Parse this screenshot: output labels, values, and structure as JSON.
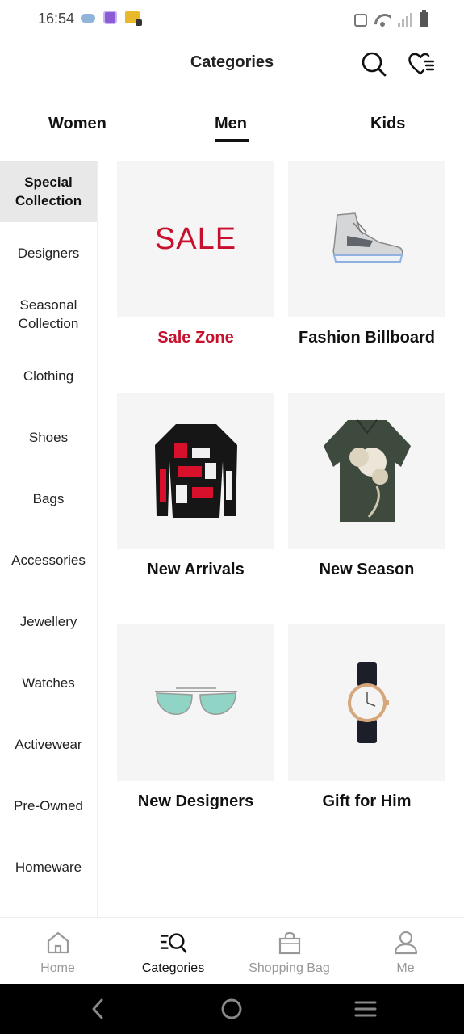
{
  "status_bar": {
    "time": "16:54"
  },
  "header": {
    "title": "Categories",
    "icons": [
      "search-icon",
      "wishlist-heart-icon"
    ]
  },
  "gender_tabs": {
    "items": [
      {
        "label": "Women",
        "active": false
      },
      {
        "label": "Men",
        "active": true
      },
      {
        "label": "Kids",
        "active": false
      }
    ]
  },
  "sidebar": {
    "items": [
      {
        "label": "Special Collection",
        "active": true
      },
      {
        "label": "Designers"
      },
      {
        "label": "Seasonal Collection"
      },
      {
        "label": "Clothing"
      },
      {
        "label": "Shoes"
      },
      {
        "label": "Bags"
      },
      {
        "label": "Accessories"
      },
      {
        "label": "Jewellery"
      },
      {
        "label": "Watches"
      },
      {
        "label": "Activewear"
      },
      {
        "label": "Pre-Owned"
      },
      {
        "label": "Homeware"
      }
    ]
  },
  "tiles": [
    {
      "label": "Sale Zone",
      "image_text": "SALE",
      "image": "sale-banner",
      "accent": "#c8102e"
    },
    {
      "label": "Fashion Billboard",
      "image": "sneaker-image"
    },
    {
      "label": "New Arrivals",
      "image": "sweater-image"
    },
    {
      "label": "New Season",
      "image": "floral-shirt-image"
    },
    {
      "label": "New Designers",
      "image": "sunglasses-image"
    },
    {
      "label": "Gift for Him",
      "image": "watch-image"
    }
  ],
  "bottom_nav": {
    "items": [
      {
        "label": "Home",
        "icon": "home-icon",
        "active": false
      },
      {
        "label": "Categories",
        "icon": "categories-search-icon",
        "active": true
      },
      {
        "label": "Shopping Bag",
        "icon": "shopping-bag-icon",
        "active": false
      },
      {
        "label": "Me",
        "icon": "profile-icon",
        "active": false
      }
    ]
  },
  "colors": {
    "accent_red": "#c8102e",
    "active_sidebar_bg": "#e8e8e8",
    "tile_bg": "#f5f5f5"
  }
}
